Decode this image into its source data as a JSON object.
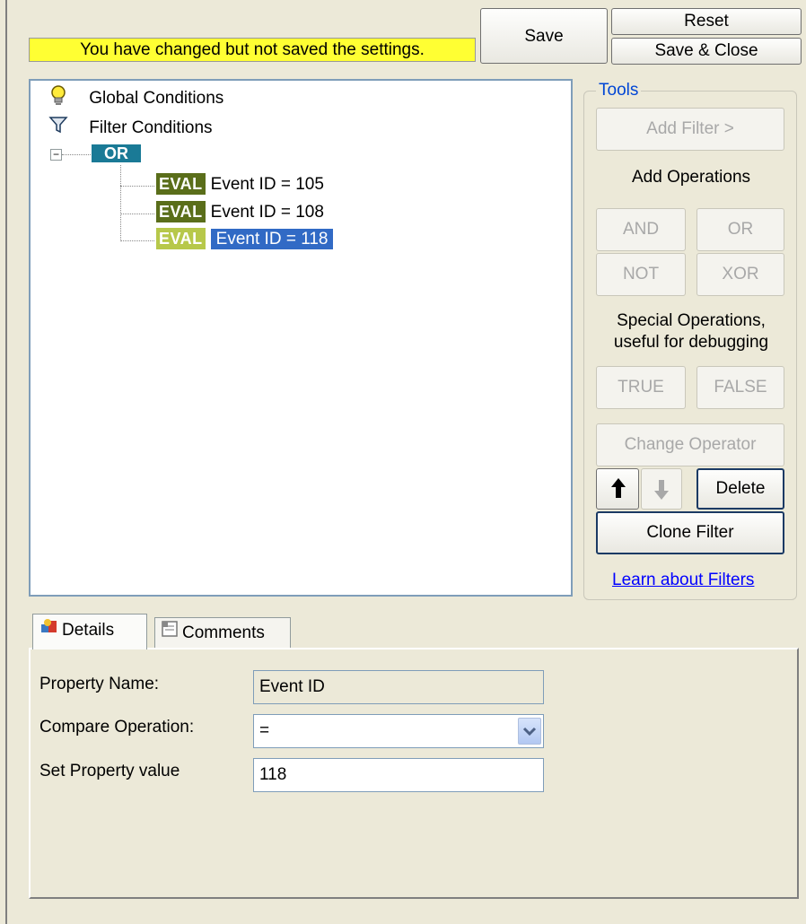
{
  "status": {
    "unsaved_message": "You have changed but not saved the settings."
  },
  "toolbar": {
    "save_label": "Save",
    "reset_label": "Reset",
    "save_close_label": "Save & Close"
  },
  "tree": {
    "global_conditions": "Global Conditions",
    "filter_conditions": "Filter Conditions",
    "operator": "OR",
    "expand_toggle": "−",
    "eval_badge": "EVAL",
    "items": [
      {
        "label": "Event ID = 105",
        "selected": false
      },
      {
        "label": "Event ID = 108",
        "selected": false
      },
      {
        "label": "Event ID = 118",
        "selected": true
      }
    ]
  },
  "tools": {
    "group_label": "Tools",
    "add_filter": "Add Filter >",
    "add_operations_label": "Add Operations",
    "and": "AND",
    "or": "OR",
    "not": "NOT",
    "xor": "XOR",
    "special_label": "Special Operations, useful for debugging",
    "true": "TRUE",
    "false": "FALSE",
    "change_operator": "Change Operator",
    "delete": "Delete",
    "clone_filter": "Clone Filter",
    "learn_link": "Learn about Filters"
  },
  "tabs": [
    {
      "label": "Details",
      "active": true
    },
    {
      "label": "Comments",
      "active": false
    }
  ],
  "details": {
    "property_name_label": "Property Name:",
    "property_name_value": "Event ID",
    "compare_label": "Compare Operation:",
    "compare_value": "=",
    "set_value_label": "Set Property value",
    "set_value_value": "118"
  },
  "colors": {
    "warning_bg": "#ffff33",
    "eval_badge": "#5a6e1a",
    "selection": "#316ac5",
    "or_node": "#1a7a96"
  }
}
